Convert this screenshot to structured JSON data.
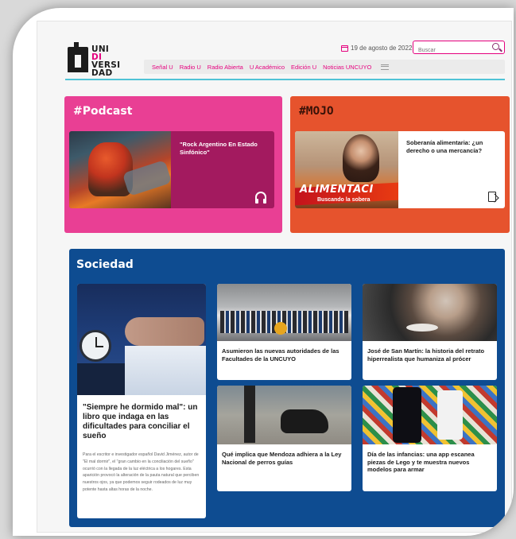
{
  "header": {
    "logo_lines": [
      "UNI",
      "DI",
      "VERSI",
      "DAD"
    ],
    "date": "19 de agosto de 2022",
    "search_placeholder": "Buscar",
    "nav": [
      "Señal U",
      "Radio U",
      "Radio Abierta",
      "U Académico",
      "Edición U",
      "Noticias UNCUYO"
    ]
  },
  "podcast": {
    "title": "#Podcast",
    "card_title": "\"Rock Argentino En Estado Sinfónico\"",
    "icon": "headphones-icon"
  },
  "mojo": {
    "title": "#MOJO",
    "card_title": "Soberanía alimentaria: ¿un derecho o una mercancía?",
    "banner": "ALIMENTACI",
    "banner_sub": "Buscando la sobera",
    "icon": "document-icon"
  },
  "sociedad": {
    "title": "Sociedad",
    "featured": {
      "title": "\"Siempre he dormido mal\": un libro que indaga en las dificultades para conciliar el sueño",
      "body": "Para el escritor e investigador español David Jiménez, autor de \"El mal dormir\", el \"gran cambio en la conciliación del sueño\" ocurrió con la llegada de la luz eléctrica a los hogares. Esta aparición provocó la alteración de la pauta natural que perciben nuestros ojos, ya que podemos seguir rodeados de luz muy potente hasta altas horas de la noche."
    },
    "cards": [
      {
        "title": "Asumieron las nuevas autoridades de las Facultades de la UNCUYO"
      },
      {
        "title": "José de San Martín: la historia del retrato hiperrealista que humaniza al prócer"
      },
      {
        "title": "Qué implica que Mendoza adhiera a la Ley Nacional de perros guías"
      },
      {
        "title": "Día de las infancias: una app escanea piezas de Lego y te muestra nuevos modelos para armar"
      }
    ]
  },
  "colors": {
    "brand_pink": "#e5007e",
    "podcast_bg": "#e93f94",
    "mojo_bg": "#e6532d",
    "sociedad_bg": "#0e4c91",
    "accent_rule": "#4fc3d6"
  }
}
